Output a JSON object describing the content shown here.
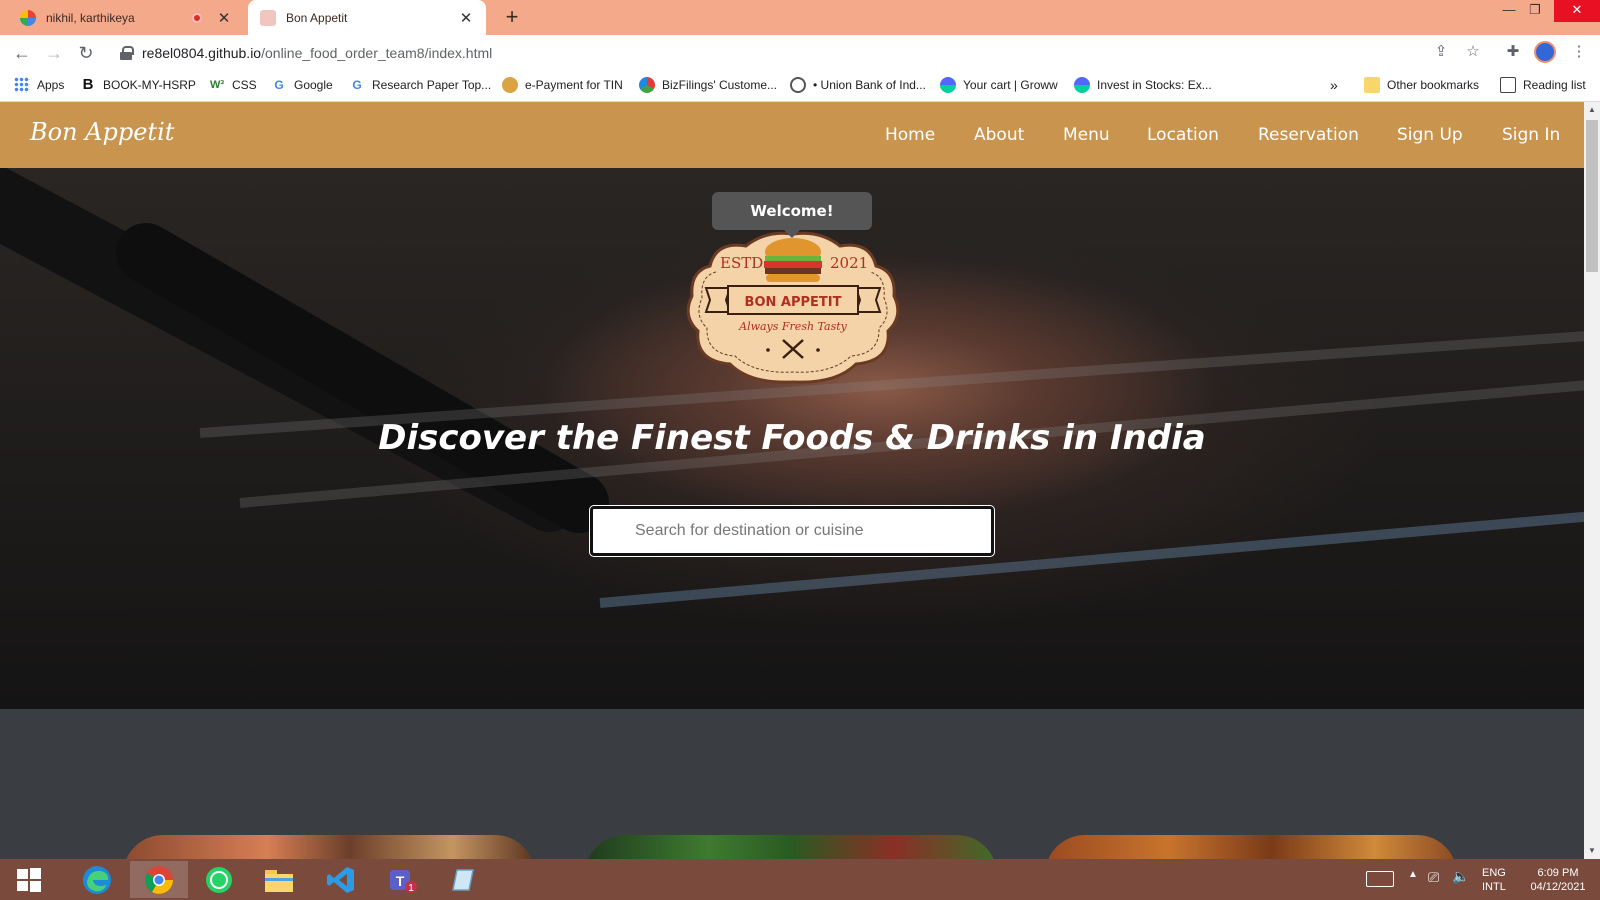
{
  "browser": {
    "tabs": [
      {
        "title": "nikhil, karthikeya"
      },
      {
        "title": "Bon Appetit"
      }
    ],
    "url_host": "re8el0804.github.io",
    "url_path": "/online_food_order_team8/index.html",
    "bookmarks": [
      {
        "label": "Apps"
      },
      {
        "label": "BOOK-MY-HSRP"
      },
      {
        "label": "CSS"
      },
      {
        "label": "Google"
      },
      {
        "label": "Research Paper Top..."
      },
      {
        "label": "e-Payment for TIN"
      },
      {
        "label": "BizFilings' Custome..."
      },
      {
        "label": "• Union Bank of Ind..."
      },
      {
        "label": "Your cart | Groww"
      },
      {
        "label": "Invest in Stocks: Ex..."
      },
      {
        "label": "Other bookmarks"
      },
      {
        "label": "Reading list"
      }
    ],
    "overflow": "»"
  },
  "site": {
    "brand": "Bon Appetit",
    "nav": [
      "Home",
      "About",
      "Menu",
      "Location",
      "Reservation",
      "Sign Up",
      "Sign In"
    ],
    "tooltip": "Welcome!",
    "logo": {
      "left": "ESTD",
      "right": "2021",
      "banner": "BON APPETIT",
      "tagline": "Always Fresh Tasty"
    },
    "headline": "Discover the Finest Foods & Drinks in India",
    "search_placeholder": "Search for destination or cuisine"
  },
  "taskbar": {
    "lang_1": "ENG",
    "lang_2": "INTL",
    "time": "6:09 PM",
    "date": "04/12/2021",
    "teams_badge": "1"
  },
  "colors": {
    "tabstrip": "#f4a98b",
    "navbar": "#c9944e",
    "taskbar": "#7a4a3c"
  }
}
